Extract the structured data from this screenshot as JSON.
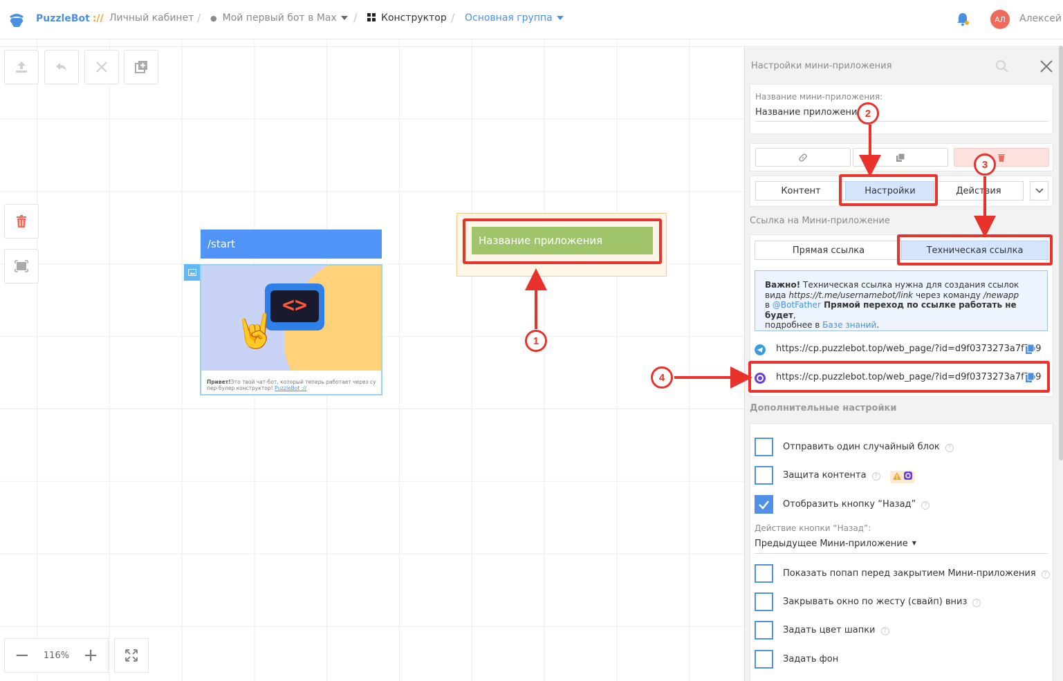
{
  "header": {
    "brand": "PuzzleBot",
    "brand_slashes": "://",
    "crumb_cabinet": "Личный кабинет",
    "crumb_bot": "Мой первый бот в Max",
    "crumb_constructor": "Конструктор",
    "crumb_group": "Основная группа",
    "avatar_initials": "АЛ",
    "user_name": "Алексей"
  },
  "canvas": {
    "start_block_title": "/start",
    "card_text_bold": "Привет!",
    "card_text": "Это твой чат-бот, который теперь работает через су пер-булер конструктор!",
    "card_link": "PuzzleBot ://",
    "card_screen": "<>",
    "webapp_button": "Название приложения",
    "zoom_level": "116%"
  },
  "annotations": [
    "1",
    "2",
    "3",
    "4"
  ],
  "panel": {
    "title": "Настройки мини-приложения",
    "name_label": "Название мини-приложения:",
    "name_value": "Название приложения",
    "tabs": [
      "Контент",
      "Настройки",
      "Действия"
    ],
    "link_section_title": "Ссылка на Мини-приложение",
    "link_tabs": [
      "Прямая ссылка",
      "Техническая ссылка"
    ],
    "info": {
      "bold1": "Важно!",
      "t1": " Техническая ссылка нужна для создания ссылок вида ",
      "i1": "https://t.me/usernamebot/link",
      "t2": " через команду ",
      "i2": "/newapp",
      "t3": "в ",
      "a1": "@BotFather",
      "bold2": " Прямой переход по ссылке работать не будет",
      "t4": ",",
      "t5": "подробнее в ",
      "a2": "Базе знаний",
      "t6": "."
    },
    "url_telegram": "https://cp.puzzlebot.top/web_page/?id=d9f0373273a7f7b9",
    "url_max": "https://cp.puzzlebot.top/web_page/?id=d9f0373273a7f7b9",
    "extra_title": "Дополнительные настройки",
    "options": [
      {
        "label": "Отправить один случайный блок",
        "checked": false
      },
      {
        "label": "Защита контента",
        "checked": false
      },
      {
        "label": "Отобразить кнопку “Назад”",
        "checked": true
      }
    ],
    "back_action_label": "Действие кнопки “Назад”:",
    "back_action_value": "Предыдущее Мини-приложение",
    "options2": [
      {
        "label": "Показать попап перед закрытием Мини-приложения",
        "checked": false
      },
      {
        "label": "Закрывать окно по жесту (свайп) вниз",
        "checked": false
      },
      {
        "label": "Задать цвет шапки",
        "checked": false
      },
      {
        "label": "Задать фон",
        "checked": false
      }
    ]
  },
  "colors": {
    "accent": "#4a90e2",
    "annotation_red": "#e8322b",
    "webapp_green": "#a0c46a",
    "start_blue": "#4f94f6"
  }
}
